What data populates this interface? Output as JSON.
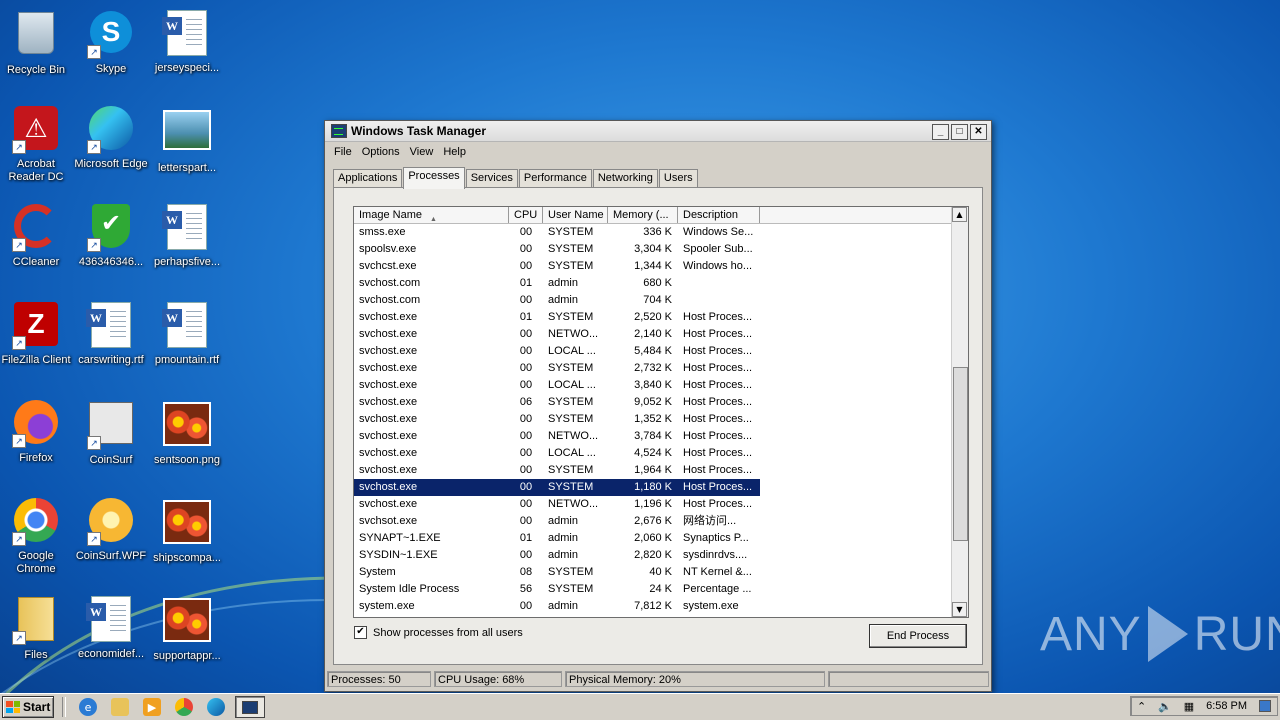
{
  "desktop": {
    "icons": [
      {
        "label": "Recycle Bin",
        "icon": "recycle-bin-icon"
      },
      {
        "label": "Skype",
        "icon": "skype-icon"
      },
      {
        "label": "jerseyspeci...",
        "icon": "word-document-icon"
      },
      {
        "label": "Acrobat Reader DC",
        "icon": "acrobat-reader-icon"
      },
      {
        "label": "Microsoft Edge",
        "icon": "edge-icon"
      },
      {
        "label": "letterspart...",
        "icon": "image-file-icon"
      },
      {
        "label": "CCleaner",
        "icon": "ccleaner-icon"
      },
      {
        "label": "436346346...",
        "icon": "shield-icon"
      },
      {
        "label": "perhapsfive...",
        "icon": "word-document-icon"
      },
      {
        "label": "FileZilla Client",
        "icon": "filezilla-icon"
      },
      {
        "label": "carswriting.rtf",
        "icon": "word-document-icon"
      },
      {
        "label": "pmountain.rtf",
        "icon": "word-document-icon"
      },
      {
        "label": "Firefox",
        "icon": "firefox-icon"
      },
      {
        "label": "CoinSurf",
        "icon": "coinsurf-icon"
      },
      {
        "label": "sentsoon.png",
        "icon": "image-file-icon"
      },
      {
        "label": "Google Chrome",
        "icon": "chrome-icon"
      },
      {
        "label": "CoinSurf.WPF",
        "icon": "coinsurf-wpf-icon"
      },
      {
        "label": "shipscompa...",
        "icon": "image-file-icon"
      },
      {
        "label": "Files",
        "icon": "files-folder-icon"
      },
      {
        "label": "economidef...",
        "icon": "word-document-icon"
      },
      {
        "label": "supportappr...",
        "icon": "image-file-icon"
      }
    ]
  },
  "window": {
    "title": "Windows Task Manager",
    "buttons": {
      "minimize": "_",
      "maximize": "□",
      "close": "✕"
    },
    "menu": [
      "File",
      "Options",
      "View",
      "Help"
    ],
    "tabs": [
      "Applications",
      "Processes",
      "Services",
      "Performance",
      "Networking",
      "Users"
    ],
    "active_tab": "Processes"
  },
  "process_table": {
    "columns": [
      "Image Name",
      "CPU",
      "User Name",
      "Memory (...",
      "Description"
    ],
    "sort_indicator": "▲",
    "selected_index": 15,
    "rows": [
      [
        "smss.exe",
        "00",
        "SYSTEM",
        "336 K",
        "Windows Se..."
      ],
      [
        "spoolsv.exe",
        "00",
        "SYSTEM",
        "3,304 K",
        "Spooler Sub..."
      ],
      [
        "svchcst.exe",
        "00",
        "SYSTEM",
        "1,344 K",
        "Windows ho..."
      ],
      [
        "svchost.com",
        "01",
        "admin",
        "680 K",
        ""
      ],
      [
        "svchost.com",
        "00",
        "admin",
        "704 K",
        ""
      ],
      [
        "svchost.exe",
        "01",
        "SYSTEM",
        "2,520 K",
        "Host Proces..."
      ],
      [
        "svchost.exe",
        "00",
        "NETWO...",
        "2,140 K",
        "Host Proces..."
      ],
      [
        "svchost.exe",
        "00",
        "LOCAL ...",
        "5,484 K",
        "Host Proces..."
      ],
      [
        "svchost.exe",
        "00",
        "SYSTEM",
        "2,732 K",
        "Host Proces..."
      ],
      [
        "svchost.exe",
        "00",
        "LOCAL ...",
        "3,840 K",
        "Host Proces..."
      ],
      [
        "svchost.exe",
        "06",
        "SYSTEM",
        "9,052 K",
        "Host Proces..."
      ],
      [
        "svchost.exe",
        "00",
        "SYSTEM",
        "1,352 K",
        "Host Proces..."
      ],
      [
        "svchost.exe",
        "00",
        "NETWO...",
        "3,784 K",
        "Host Proces..."
      ],
      [
        "svchost.exe",
        "00",
        "LOCAL ...",
        "4,524 K",
        "Host Proces..."
      ],
      [
        "svchost.exe",
        "00",
        "SYSTEM",
        "1,964 K",
        "Host Proces..."
      ],
      [
        "svchost.exe",
        "00",
        "SYSTEM",
        "1,180 K",
        "Host Proces..."
      ],
      [
        "svchost.exe",
        "00",
        "NETWO...",
        "1,196 K",
        "Host Proces..."
      ],
      [
        "svchsot.exe",
        "00",
        "admin",
        "2,676 K",
        "网络访问..."
      ],
      [
        "SYNAPT~1.EXE",
        "01",
        "admin",
        "2,060 K",
        "Synaptics P..."
      ],
      [
        "SYSDIN~1.EXE",
        "00",
        "admin",
        "2,820 K",
        "sysdinrdvs...."
      ],
      [
        "System",
        "08",
        "SYSTEM",
        "40 K",
        "NT Kernel &..."
      ],
      [
        "System Idle Process",
        "56",
        "SYSTEM",
        "24 K",
        "Percentage ..."
      ],
      [
        "system.exe",
        "00",
        "admin",
        "7,812 K",
        "system.exe"
      ]
    ]
  },
  "options": {
    "show_all_users_label": "Show processes from all users",
    "show_all_users_checked": true,
    "end_process_label": "End Process"
  },
  "status": {
    "processes": "Processes: 50",
    "cpu": "CPU Usage: 68%",
    "memory": "Physical Memory: 20%"
  },
  "taskbar": {
    "start_label": "Start",
    "pinned": [
      "internet-explorer-icon",
      "explorer-folder-icon",
      "media-player-icon",
      "chrome-icon",
      "edge-icon"
    ],
    "active_task_icon": "task-manager-icon",
    "clock": "6:58 PM"
  },
  "watermark": {
    "left": "ANY",
    "right": "RUN"
  }
}
